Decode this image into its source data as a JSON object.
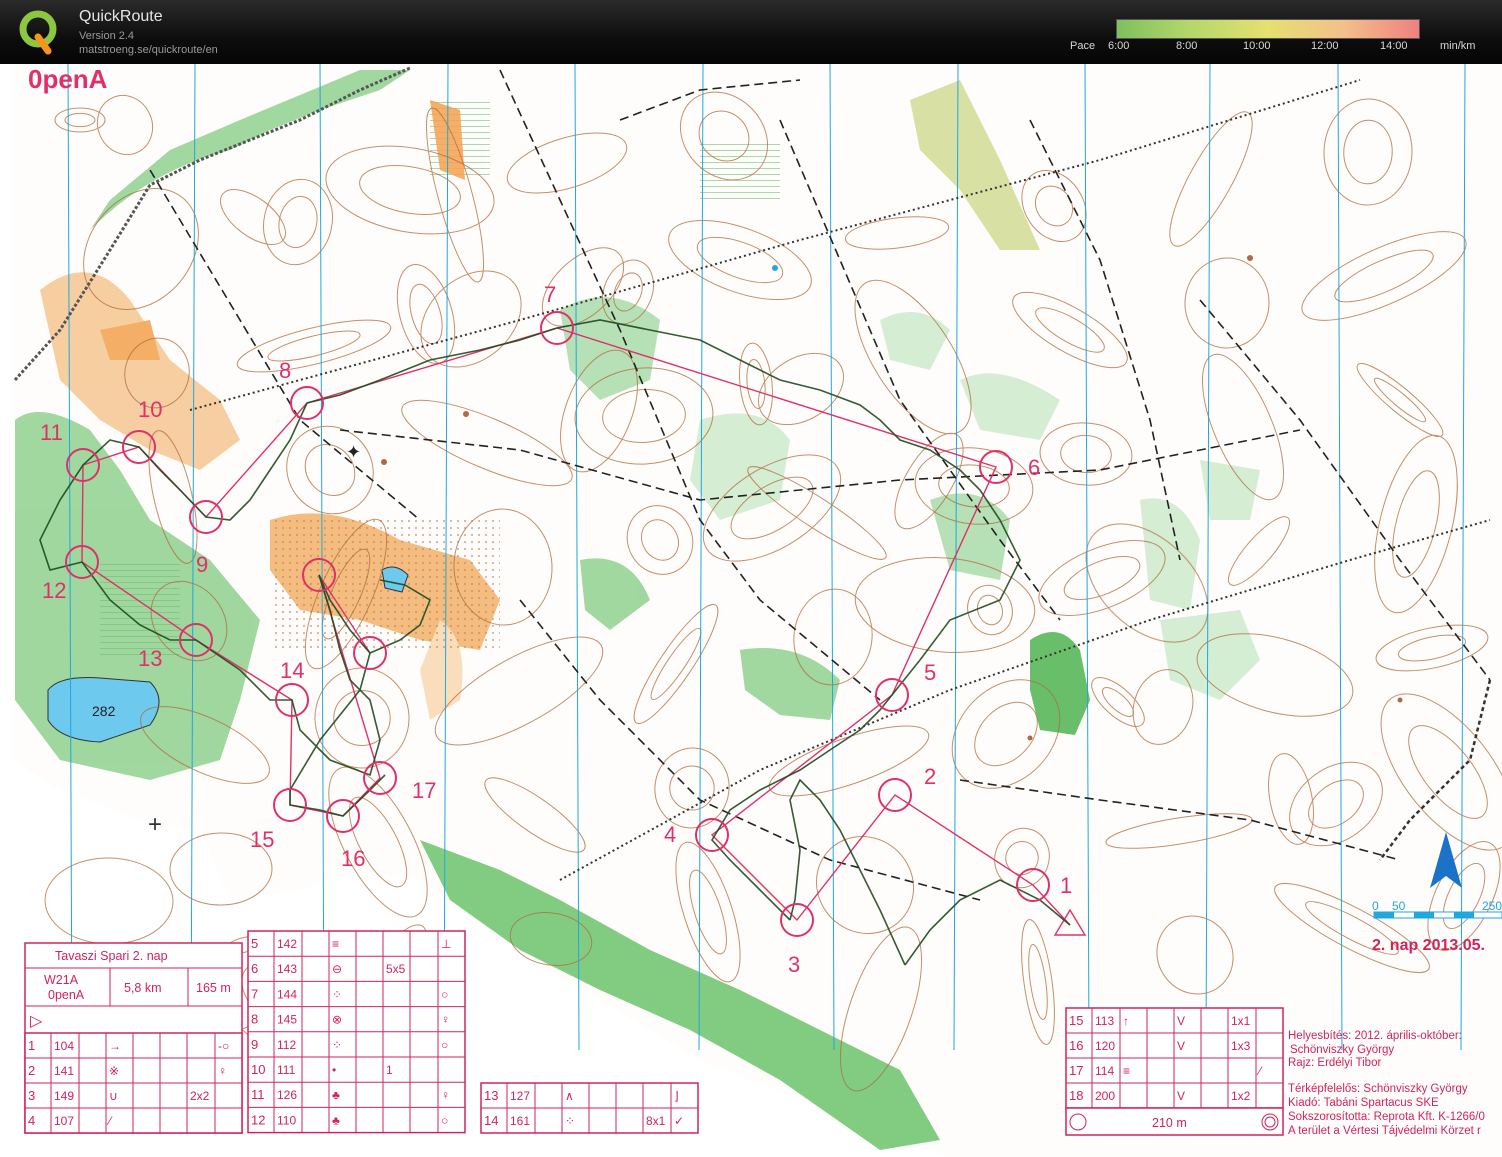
{
  "app": {
    "title": "QuickRoute",
    "version": "Version 2.4",
    "url": "matstroeng.se/quickroute/en"
  },
  "pace": {
    "label": "Pace",
    "ticks": [
      "6:00",
      "8:00",
      "10:00",
      "12:00",
      "14:00"
    ],
    "unit": "min/km"
  },
  "colors": {
    "course": "#e0306a",
    "route": "#1f4a1f",
    "contour": "#b06a3d",
    "green": "#6cc36c",
    "yellow": "#f4b26b",
    "water": "#66c8ee",
    "magnetic_north": "#1da8e0"
  },
  "map": {
    "class_title": "0penA",
    "date": "2. nap 2013.05.",
    "lake_height": "282",
    "controls": [
      "1",
      "2",
      "3",
      "4",
      "5",
      "6",
      "7",
      "8",
      "9",
      "10",
      "11",
      "12",
      "13",
      "14",
      "15",
      "16",
      "17"
    ],
    "scale_numbers": [
      "0",
      "50",
      "250"
    ],
    "north_arrow": "north-arrow-icon"
  },
  "description_sheet": {
    "event": "Tavaszi Spari 2. nap",
    "class": "W21A\n0penA",
    "length": "5,8 km",
    "climb": "165 m",
    "start": "▷",
    "rows_a": [
      {
        "n": "1",
        "code": "104",
        "sym": "→",
        "dim": "",
        "extra": "-○"
      },
      {
        "n": "2",
        "code": "141",
        "sym": "※",
        "dim": "",
        "extra": "♀"
      },
      {
        "n": "3",
        "code": "149",
        "sym": "∪",
        "dim": "2x2",
        "extra": ""
      },
      {
        "n": "4",
        "code": "107",
        "sym": "⁄",
        "dim": "",
        "extra": ""
      }
    ],
    "rows_b": [
      {
        "n": "5",
        "code": "142",
        "sym": "≡",
        "dim": "",
        "extra": "⊥"
      },
      {
        "n": "6",
        "code": "143",
        "sym": "⊖",
        "dim": "5x5",
        "extra": ""
      },
      {
        "n": "7",
        "code": "144",
        "sym": "⁘",
        "dim": "",
        "extra": "○"
      },
      {
        "n": "8",
        "code": "145",
        "sym": "⊗",
        "dim": "",
        "extra": "♀"
      },
      {
        "n": "9",
        "code": "112",
        "sym": "⁘",
        "dim": "",
        "extra": "○"
      },
      {
        "n": "10",
        "code": "111",
        "sym": "•",
        "dim": "1",
        "extra": ""
      },
      {
        "n": "11",
        "code": "126",
        "sym": "♣",
        "dim": "",
        "extra": "♀"
      },
      {
        "n": "12",
        "code": "110",
        "sym": "♣",
        "dim": "",
        "extra": "○"
      }
    ],
    "rows_c": [
      {
        "n": "13",
        "code": "127",
        "sym": "∧",
        "dim": "",
        "extra": "⌋"
      },
      {
        "n": "14",
        "code": "161",
        "sym": "⁘",
        "dim": "8x1",
        "extra": "✓"
      }
    ],
    "rows_d": [
      {
        "n": "15",
        "code": "113",
        "sym": "↑",
        "s2": "V",
        "dim": "1x1",
        "extra": ""
      },
      {
        "n": "16",
        "code": "120",
        "sym": "",
        "s2": "V",
        "dim": "1x3",
        "extra": ""
      },
      {
        "n": "17",
        "code": "114",
        "sym": "≡",
        "s2": "",
        "dim": "",
        "extra": "⁄"
      },
      {
        "n": "18",
        "code": "200",
        "sym": "",
        "s2": "V",
        "dim": "1x2",
        "extra": ""
      }
    ],
    "finish": "210 m"
  },
  "credits": [
    "Helyesbítés: 2012. április-október:",
    "Schönviszky György",
    "Rajz: Erdélyi Tibor",
    "Térképfelelős: Schönviszky György",
    "Kiadó: Tabáni Spartacus SKE",
    "Sokszorosította: Reprota Kft. K-1266/0",
    "A terület a Vértesi Tájvédelmi Körzet r"
  ]
}
